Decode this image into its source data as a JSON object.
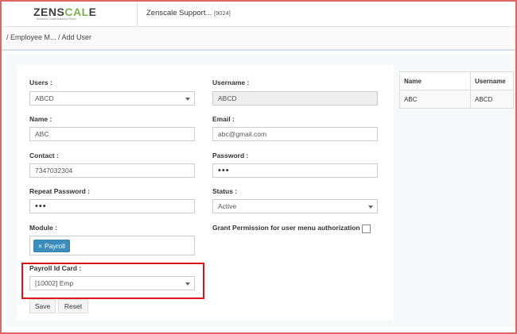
{
  "header": {
    "logo_text_a": "ZENS",
    "logo_text_b": "CAL",
    "logo_text_c": "E",
    "logo_tagline": "Business Goals Business Flows",
    "app_title": "Zenscale Support...",
    "app_code": "[9024]"
  },
  "breadcrumb": "/ Employee M... / Add User",
  "form": {
    "users": {
      "label": "Users :",
      "value": "ABCD"
    },
    "username": {
      "label": "Username :",
      "value": "ABCD"
    },
    "name": {
      "label": "Name :",
      "value": "ABC"
    },
    "email": {
      "label": "Email :",
      "value": "abc@gmail.com"
    },
    "contact": {
      "label": "Contact :",
      "value": "7347032304"
    },
    "password": {
      "label": "Password :",
      "value": "•••"
    },
    "repeat_password": {
      "label": "Repeat Password :",
      "value": "•••"
    },
    "status": {
      "label": "Status :",
      "value": "Active"
    },
    "module": {
      "label": "Module :",
      "tag_remove": "×",
      "tag": "Payroll"
    },
    "grant_permission": {
      "label": "Grant Permission for user menu authorization :",
      "checked": false
    },
    "payroll_id_card": {
      "label": "Payroll Id Card :",
      "value": "[10002] Emp"
    },
    "save_label": "Save",
    "reset_label": "Reset"
  },
  "table": {
    "headers": [
      "Name",
      "Username"
    ],
    "rows": [
      [
        "ABC",
        "ABCD"
      ]
    ]
  },
  "colors": {
    "highlight": "#d9141b",
    "tag": "#3c8dbc",
    "frame": "#e06666"
  }
}
